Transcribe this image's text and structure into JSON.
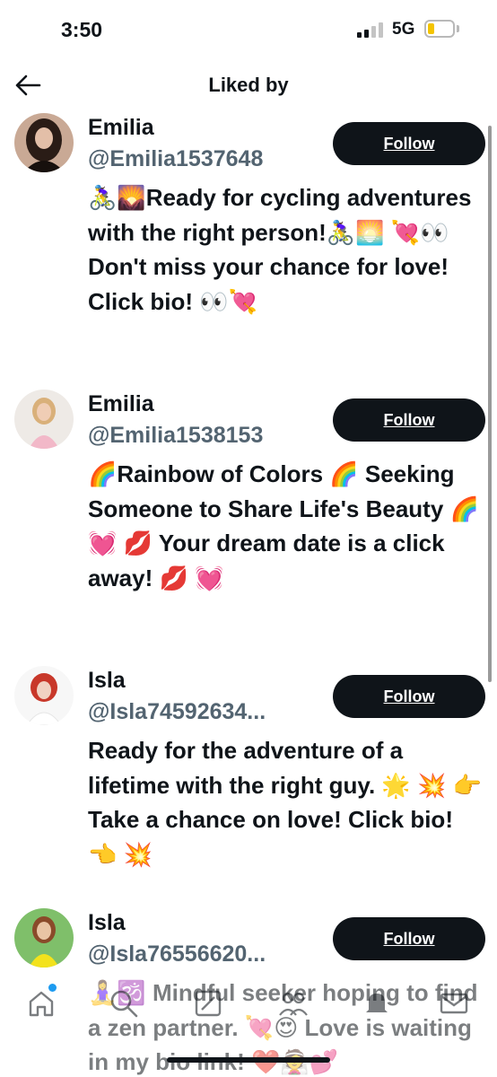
{
  "status_bar": {
    "time": "3:50",
    "network": "5G",
    "battery_level": 0.2,
    "battery_color": "#f4c400"
  },
  "header": {
    "title": "Liked by",
    "back_icon": "arrow-left-icon"
  },
  "colors": {
    "text": "#0f1419",
    "secondary": "#536471",
    "button_bg": "#0f1419",
    "button_text": "#ffffff",
    "accent": "#1d9bf0"
  },
  "users": [
    {
      "name": "Emilia",
      "handle": "@Emilia1537648",
      "follow_label": "Follow",
      "bio": "🚴‍♀️🌄Ready for cycling adventures with the right person!🚴‍♀️🌅 💘👀 Don't miss your chance for love! Click bio! 👀💘"
    },
    {
      "name": "Emilia",
      "handle": "@Emilia1538153",
      "follow_label": "Follow",
      "bio": "🌈Rainbow of Colors 🌈 Seeking Someone to Share Life's Beauty 🌈 💓 💋 Your dream date is a click away! 💋 💓"
    },
    {
      "name": "Isla",
      "handle": "@Isla74592634...",
      "follow_label": "Follow",
      "bio": "Ready for the adventure of a lifetime with the right guy. 🌟 💥 👉 Take a chance on love! Click bio! 👈 💥"
    },
    {
      "name": "Isla",
      "handle": "@Isla76556620...",
      "follow_label": "Follow",
      "bio": "🧘‍♀️🕉️ Mindful seeker hoping to find a zen partner. 💘😍 Love is waiting in my bio link! ❤️👰💕"
    }
  ],
  "tab_bar": {
    "tabs": [
      "home-icon",
      "search-icon",
      "compose-icon",
      "communities-icon",
      "notifications-icon",
      "messages-icon"
    ],
    "has_unread_dot": true
  }
}
